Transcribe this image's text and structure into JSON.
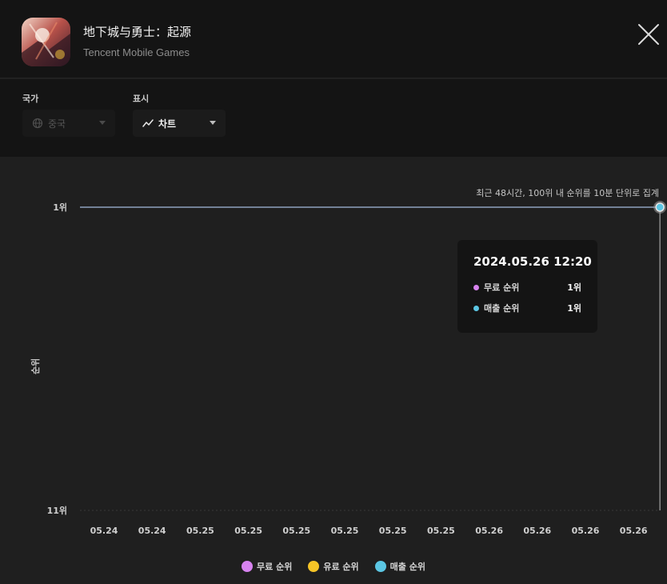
{
  "app": {
    "title": "地下城与勇士：起源",
    "developer": "Tencent Mobile Games",
    "icon": "app-icon"
  },
  "controls": {
    "country_label": "국가",
    "country_value": "중국",
    "country_icon": "globe-icon",
    "view_label": "표시",
    "view_value": "차트",
    "view_icon": "line-chart-icon"
  },
  "colors": {
    "free_rank": "#d783ef",
    "paid_rank": "#f5c427",
    "revenue_rank": "#5bc6e3",
    "line": "#8da2bd"
  },
  "chart_data": {
    "type": "line",
    "note": "최근 48시간, 100위 내 순위를 10분 단위로 집계",
    "ylabel": "순위",
    "y_ticks": [
      "1위",
      "11위"
    ],
    "ylim": [
      1,
      11
    ],
    "y_inverted": true,
    "x_ticks": [
      "05.24",
      "05.24",
      "05.25",
      "05.25",
      "05.25",
      "05.25",
      "05.25",
      "05.25",
      "05.26",
      "05.26",
      "05.26",
      "05.26"
    ],
    "grid": true,
    "legend_position": "bottom",
    "legend": [
      "무료 순위",
      "유료 순위",
      "매출 순위"
    ],
    "series": [
      {
        "name": "매출 순위",
        "color": "#8da2bd",
        "start_index": 0,
        "end_index": 11.5,
        "value": 1
      }
    ],
    "highlight": {
      "series": "매출 순위",
      "index": 11,
      "value": 1
    }
  },
  "tooltip": {
    "date": "2024.05.26 12:20",
    "rows": [
      {
        "label": "무료 순위",
        "value": "1위"
      },
      {
        "label": "매출 순위",
        "value": "1위"
      }
    ]
  }
}
